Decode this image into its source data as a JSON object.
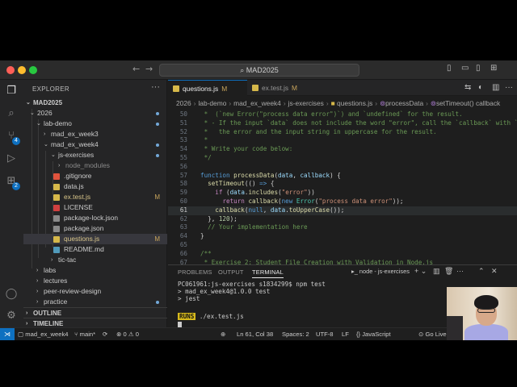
{
  "titlebar": {
    "search_text": "MAD2025"
  },
  "activity_bar": {
    "badges": [
      "4",
      "2"
    ]
  },
  "sidebar": {
    "header": "EXPLORER",
    "root": "MAD2025",
    "tree": [
      {
        "label": "2026",
        "type": "folder",
        "open": true
      },
      {
        "label": "lab-demo",
        "type": "folder",
        "open": true
      },
      {
        "label": "mad_ex_week3",
        "type": "folder",
        "open": false
      },
      {
        "label": "mad_ex_week4",
        "type": "folder",
        "open": true
      },
      {
        "label": "js-exercises",
        "type": "folder",
        "open": true
      },
      {
        "label": "node_modules",
        "type": "folder",
        "open": false
      },
      {
        "label": ".gitignore",
        "type": "git"
      },
      {
        "label": "data.js",
        "type": "js"
      },
      {
        "label": "ex.test.js",
        "type": "js",
        "badge": "M"
      },
      {
        "label": "LICENSE",
        "type": "license"
      },
      {
        "label": "package-lock.json",
        "type": "json"
      },
      {
        "label": "package.json",
        "type": "json"
      },
      {
        "label": "questions.js",
        "type": "js",
        "badge": "M"
      },
      {
        "label": "README.md",
        "type": "md"
      },
      {
        "label": "tic-tac",
        "type": "folder",
        "open": false
      },
      {
        "label": "labs",
        "type": "folder",
        "open": false
      },
      {
        "label": "lectures",
        "type": "folder",
        "open": false
      },
      {
        "label": "peer-review-design",
        "type": "folder",
        "open": false
      },
      {
        "label": "practice",
        "type": "folder",
        "open": false
      }
    ],
    "sections": [
      "OUTLINE",
      "TIMELINE"
    ]
  },
  "tabs": [
    {
      "label": "questions.js",
      "badge": "M",
      "active": true
    },
    {
      "label": "ex.test.js",
      "badge": "M",
      "active": false
    }
  ],
  "breadcrumbs": [
    "2026",
    "lab-demo",
    "mad_ex_week4",
    "js-exercises",
    "questions.js",
    "processData",
    "setTimeout() callback"
  ],
  "code": {
    "line_numbers": [
      "50",
      "51",
      "52",
      "53",
      "54",
      "55",
      "56",
      "57",
      "58",
      "59",
      "60",
      "61",
      "62",
      "63",
      "64",
      "65",
      "66",
      "67"
    ],
    "current_line": "61"
  },
  "panel": {
    "tabs": [
      "PROBLEMS",
      "OUTPUT",
      "TERMINAL"
    ],
    "active_tab": "TERMINAL",
    "terminal_name": "node - js-exercises",
    "lines": [
      "PC061961:js-exercises s1834299$ npm test",
      "> mad_ex_week4@1.0.0 test",
      "> jest"
    ],
    "runs_badge": "RUNS",
    "runs_file": "./ex.test.js"
  },
  "statusbar": {
    "branch_root": "mad_ex_week4",
    "branch": "main*",
    "errors": "0",
    "warnings": "0",
    "position": "Ln 61, Col 38",
    "spaces": "Spaces: 2",
    "encoding": "UTF-8",
    "eol": "LF",
    "language": "JavaScript",
    "golive": "Go Live"
  },
  "colors": {
    "accent": "#0e70c0",
    "modified": "#c8a45b",
    "runs": "#d7ba1c"
  }
}
